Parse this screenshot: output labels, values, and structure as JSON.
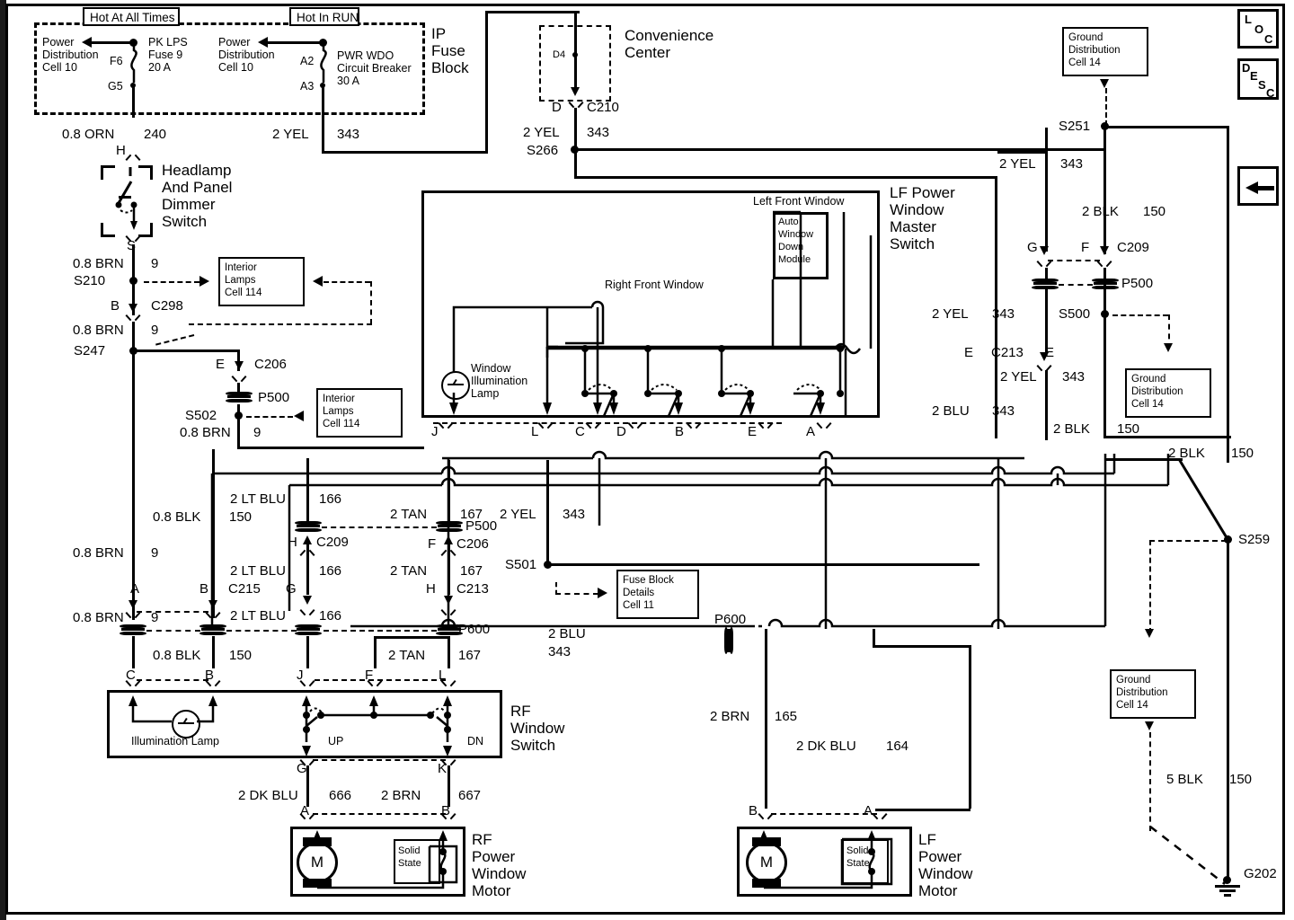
{
  "diagram": {
    "title": "Power Windows Wiring Diagram",
    "nav_buttons": [
      {
        "name": "loc-button",
        "label": "LOC",
        "letters": [
          "L",
          "O",
          "C"
        ]
      },
      {
        "name": "desc-button",
        "label": "DESC",
        "letters": [
          "D",
          "E",
          "S",
          "C"
        ]
      },
      {
        "name": "back-arrow-button",
        "label": "back-arrow"
      }
    ]
  },
  "fuse_block": {
    "enclosure_label": "IP\nFuse\nBlock",
    "hot_all_times_label": "Hot At All Times",
    "hot_in_run_label": "Hot In RUN",
    "left": {
      "source_box": "Power\nDistribution\nCell 10",
      "pin_top": "F6",
      "pin_bottom": "G5",
      "device": "PK LPS\nFuse 9\n20 A"
    },
    "right": {
      "source_box": "Power\nDistribution\nCell 10",
      "pin_top": "A2",
      "pin_bottom": "A3",
      "device": "PWR WDO\nCircuit Breaker\n30 A"
    }
  },
  "convenience_center": {
    "label": "Convenience\nCenter",
    "pin": "D4",
    "conn_pin": "D",
    "conn_id": "C210"
  },
  "components": {
    "dimmer_switch": "Headlamp\nAnd Panel\nDimmer\nSwitch",
    "dimmer_in_pin": "H",
    "dimmer_out_pin": "S",
    "master_switch": "LF Power\nWindow\nMaster\nSwitch",
    "master_switch_left_window": "Left Front Window",
    "master_switch_right_window": "Right Front Window",
    "auto_module": "Auto\nWindow\nDown\nModule",
    "window_illum_lamp": "Window\nIllumination\nLamp",
    "rf_window_switch": "RF\nWindow\nSwitch",
    "rf_illum_lamp": "Illumination Lamp",
    "switch_up": "UP",
    "switch_dn": "DN",
    "rf_motor": "RF\nPower\nWindow\nMotor",
    "lf_motor": "LF\nPower\nWindow\nMotor",
    "solid_state": "Solid\nState"
  },
  "cell_refs": [
    {
      "name": "interior-lamps-cell-114-top",
      "text": "Interior\nLamps\nCell 114"
    },
    {
      "name": "interior-lamps-cell-114-bottom",
      "text": "Interior\nLamps\nCell 114"
    },
    {
      "name": "fuse-block-details-cell-11",
      "text": "Fuse Block\nDetails\nCell 11"
    },
    {
      "name": "ground-distribution-cell-14-top",
      "text": "Ground\nDistribution\nCell 14"
    },
    {
      "name": "ground-distribution-cell-14-mid",
      "text": "Ground\nDistribution\nCell 14"
    },
    {
      "name": "ground-distribution-cell-14-bottom",
      "text": "Ground\nDistribution\nCell 14"
    }
  ],
  "wires": [
    {
      "name": "w-orn-240",
      "gauge_color": "0.8 ORN",
      "circuit": "240"
    },
    {
      "name": "w-yel-343-fuse",
      "gauge_color": "2 YEL",
      "circuit": "343"
    },
    {
      "name": "w-yel-343-c210",
      "gauge_color": "2 YEL",
      "circuit": "343"
    },
    {
      "name": "w-yel-343-s251",
      "gauge_color": "2 YEL",
      "circuit": "343"
    },
    {
      "name": "w-blk-150-c209",
      "gauge_color": "2 BLK",
      "circuit": "150"
    },
    {
      "name": "w-yel-343-mid",
      "gauge_color": "2 YEL",
      "circuit": "343"
    },
    {
      "name": "w-yel-343-c213",
      "gauge_color": "2 YEL",
      "circuit": "343"
    },
    {
      "name": "w-blu-343",
      "gauge_color": "2 BLU",
      "circuit": "343"
    },
    {
      "name": "w-blk-150-lower",
      "gauge_color": "2 BLK",
      "circuit": "150"
    },
    {
      "name": "w-blk-150-right",
      "gauge_color": "2 BLK",
      "circuit": "150"
    },
    {
      "name": "w-brn-9-s210",
      "gauge_color": "0.8 BRN",
      "circuit": "9"
    },
    {
      "name": "w-brn-9-s247",
      "gauge_color": "0.8 BRN",
      "circuit": "9"
    },
    {
      "name": "w-brn-9-s502",
      "gauge_color": "0.8 BRN",
      "circuit": "9"
    },
    {
      "name": "w-brn-9-a",
      "gauge_color": "0.8 BRN",
      "circuit": "9"
    },
    {
      "name": "w-brn-9-c",
      "gauge_color": "0.8 BRN",
      "circuit": "9"
    },
    {
      "name": "w-blk-150-b",
      "gauge_color": "0.8 BLK",
      "circuit": "150"
    },
    {
      "name": "w-blk-150-b2",
      "gauge_color": "0.8 BLK",
      "circuit": "150"
    },
    {
      "name": "w-ltblu-166-top",
      "gauge_color": "2 LT BLU",
      "circuit": "166"
    },
    {
      "name": "w-ltblu-166-mid",
      "gauge_color": "2 LT BLU",
      "circuit": "166"
    },
    {
      "name": "w-ltblu-166-bot",
      "gauge_color": "2 LT BLU",
      "circuit": "166"
    },
    {
      "name": "w-tan-167-top",
      "gauge_color": "2 TAN",
      "circuit": "167"
    },
    {
      "name": "w-tan-167-mid",
      "gauge_color": "2 TAN",
      "circuit": "167"
    },
    {
      "name": "w-tan-167-bot",
      "gauge_color": "2 TAN",
      "circuit": "167"
    },
    {
      "name": "w-blu-343-p600",
      "gauge_color": "2 BLU",
      "circuit": "343"
    },
    {
      "name": "w-brn-165",
      "gauge_color": "2 BRN",
      "circuit": "165"
    },
    {
      "name": "w-dkblu-164",
      "gauge_color": "2 DK BLU",
      "circuit": "164"
    },
    {
      "name": "w-dkblu-666",
      "gauge_color": "2 DK BLU",
      "circuit": "666"
    },
    {
      "name": "w-brn-667",
      "gauge_color": "2 BRN",
      "circuit": "667"
    },
    {
      "name": "w-blk-150-g202",
      "gauge_color": "5 BLK",
      "circuit": "150"
    }
  ],
  "splices": [
    {
      "name": "splice-s266",
      "id": "S266"
    },
    {
      "name": "splice-s251",
      "id": "S251"
    },
    {
      "name": "splice-s500",
      "id": "S500"
    },
    {
      "name": "splice-s210",
      "id": "S210"
    },
    {
      "name": "splice-s247",
      "id": "S247"
    },
    {
      "name": "splice-s502",
      "id": "S502"
    },
    {
      "name": "splice-s501",
      "id": "S501"
    },
    {
      "name": "splice-s259",
      "id": "S259"
    }
  ],
  "connectors": [
    {
      "name": "connector-c298",
      "id": "C298",
      "pin": "B"
    },
    {
      "name": "connector-c206-e",
      "id": "C206",
      "pin": "E"
    },
    {
      "name": "connector-c206-f",
      "id": "C206",
      "pin": "F"
    },
    {
      "name": "connector-c209-g",
      "id": "C209",
      "pin": "G"
    },
    {
      "name": "connector-c209-f",
      "id": "C209",
      "pin": "F"
    },
    {
      "name": "connector-c209-h",
      "id": "C209",
      "pin": "H"
    },
    {
      "name": "connector-c213-e",
      "id": "C213",
      "pin": "E"
    },
    {
      "name": "connector-c213-h",
      "id": "C213",
      "pin": "H"
    },
    {
      "name": "connector-c215-b",
      "id": "C215",
      "pin": "B"
    },
    {
      "name": "connector-c210-d",
      "id": "C210",
      "pin": "D"
    }
  ],
  "passthroughs": [
    {
      "name": "passthrough-p500-a",
      "id": "P500"
    },
    {
      "name": "passthrough-p500-b",
      "id": "P500"
    },
    {
      "name": "passthrough-p500-c",
      "id": "P500"
    },
    {
      "name": "passthrough-p600-a",
      "id": "P600"
    },
    {
      "name": "passthrough-p600-b",
      "id": "P600"
    }
  ],
  "grounds": [
    {
      "name": "ground-g202",
      "id": "G202"
    }
  ],
  "pins": {
    "master_switch_row": [
      "J",
      "L",
      "C",
      "D",
      "B",
      "E",
      "A"
    ],
    "rf_switch_top": [
      "C",
      "B",
      "J",
      "F",
      "L"
    ],
    "rf_switch_bottom": [
      "G",
      "K"
    ],
    "rf_motor": [
      "A",
      "B"
    ],
    "lf_motor": [
      "B",
      "A"
    ],
    "left_column": [
      "A",
      "B"
    ],
    "mid_column": [
      "G",
      "H"
    ]
  },
  "text_strings": {
    "t_hot_all": "Hot At All Times",
    "t_hot_run": "Hot In RUN",
    "t_pd_1": "Power\nDistribution\nCell 10",
    "t_pd_2": "Power\nDistribution\nCell 10",
    "t_f6": "F6",
    "t_g5": "G5",
    "t_pklps": "PK LPS\nFuse 9\n20 A",
    "t_a2": "A2",
    "t_a3": "A3",
    "t_pwrwdo": "PWR WDO\nCircuit Breaker\n30 A",
    "t_ipfuse": "IP\nFuse\nBlock",
    "t_conv": "Convenience\nCenter",
    "t_d4": "D4",
    "t_D": "D",
    "t_C210": "C210",
    "t_2yel343_a": "2 YEL",
    "t_343_a": "343",
    "t_S266": "S266",
    "t_08orn": "0.8 ORN",
    "t_240": "240",
    "t_2yel_fuse": "2 YEL",
    "t_343_fuse": "343",
    "t_H": "H",
    "t_dimmer": "Headlamp\nAnd Panel\nDimmer\nSwitch",
    "t_S": "S",
    "t_08brn_1": "0.8 BRN",
    "t_9_1": "9",
    "t_S210": "S210",
    "t_B_c298": "B",
    "t_C298": "C298",
    "t_08brn_2": "0.8 BRN",
    "t_9_2": "9",
    "t_S247": "S247",
    "t_E_c206": "E",
    "t_C206": "C206",
    "t_P500_1": "P500",
    "t_S502": "S502",
    "t_08brn_3": "0.8 BRN",
    "t_9_3": "9",
    "t_intlamp_1": "Interior\nLamps\nCell 114",
    "t_intlamp_2": "Interior\nLamps\nCell 114",
    "t_leftfrontwin": "Left Front Window",
    "t_rightfrontwin": "Right Front Window",
    "t_auto": "Auto\nWindow\nDown\nModule",
    "t_lfmaster": "LF Power\nWindow\nMaster\nSwitch",
    "t_winillum": "Window\nIllumination\nLamp",
    "t_2yel_343_ms": "2 YEL",
    "t_343_ms": "343",
    "t_E_c213": "E",
    "t_C213": "C213",
    "t_2yel_343_ms2": "2 YEL",
    "t_343_ms2": "343",
    "t_2blu_343": "2 BLU",
    "t_343_blu": "343",
    "t_2blk_150_r": "2 BLK",
    "t_150_r": "150",
    "t_grounddist_1": "Ground\nDistribution\nCell 14",
    "t_S251": "S251",
    "t_2yel_343_s": "2 YEL",
    "t_343_s": "343",
    "t_2blk_150_c209": "2 BLK",
    "t_150_c209": "150",
    "t_G_c209": "G",
    "t_F_c209": "F",
    "t_C209_r": "C209",
    "t_P500_2": "P500",
    "t_S500": "S500",
    "t_grounddist_2": "Ground\nDistribution\nCell 14",
    "t_2blk_150_far": "2 BLK",
    "t_150_far": "150",
    "t_2ltblu_166_1": "2 LT BLU",
    "t_166_1": "166",
    "t_08blk_150_1": "0.8 BLK",
    "t_150_1": "150",
    "t_2tan_167_1": "2 TAN",
    "t_167_1": "167",
    "t_P500_3": "P500",
    "t_2yel_343_b": "2 YEL",
    "t_343_b": "343",
    "t_H_c209": "H",
    "t_C209_m": "C209",
    "t_F_c206": "F",
    "t_C206_m": "C206",
    "t_08brn_4": "0.8 BRN",
    "t_9_4": "9",
    "t_2ltblu_166_2": "2 LT BLU",
    "t_166_2": "166",
    "t_2tan_167_2": "2 TAN",
    "t_167_2": "167",
    "t_S501": "S501",
    "t_fuseblockdet": "Fuse Block\nDetails\nCell 11",
    "t_A_left": "A",
    "t_B_left": "B",
    "t_C215": "C215",
    "t_G_mid": "G",
    "t_H_mid": "H",
    "t_C213_m": "C213",
    "t_08brn_5": "0.8 BRN",
    "t_9_5": "9",
    "t_2ltblu_166_3": "2 LT BLU",
    "t_166_3": "166",
    "t_P600_1": "P600",
    "t_2blu_343_2": "2 BLU",
    "t_343_2": "343",
    "t_P600_2": "P600",
    "t_08blk_150_2": "0.8 BLK",
    "t_150_2": "150",
    "t_2tan_167_3": "2 TAN",
    "t_167_3": "167",
    "t_C_pin": "C",
    "t_B_pin": "B",
    "t_J_pin": "J",
    "t_F_pin": "F",
    "t_L_pin": "L",
    "t_rfwinsw": "RF\nWindow\nSwitch",
    "t_illumlamp": "Illumination Lamp",
    "t_UP": "UP",
    "t_DN": "DN",
    "t_G_rf": "G",
    "t_K_rf": "K",
    "t_2dkblu_666": "2 DK BLU",
    "t_666": "666",
    "t_2brn_667": "2 BRN",
    "t_667": "667",
    "t_A_rfm": "A",
    "t_B_rfm": "B",
    "t_rfmotor": "RF\nPower\nWindow\nMotor",
    "t_solidstate_1": "Solid\nState",
    "t_2brn_165": "2 BRN",
    "t_165": "165",
    "t_2dkblu_164": "2 DK BLU",
    "t_164": "164",
    "t_B_lfm": "B",
    "t_A_lfm": "A",
    "t_lfmotor": "LF\nPower\nWindow\nMotor",
    "t_solidstate_2": "Solid\nState",
    "t_S259": "S259",
    "t_grounddist_3": "Ground\nDistribution\nCell 14",
    "t_5blk": "5 BLK",
    "t_150_g": "150",
    "t_G202": "G202",
    "t_ms_J": "J",
    "t_ms_L": "L",
    "t_ms_C": "C",
    "t_ms_D": "D",
    "t_ms_B": "B",
    "t_ms_E": "E",
    "t_ms_A": "A"
  }
}
